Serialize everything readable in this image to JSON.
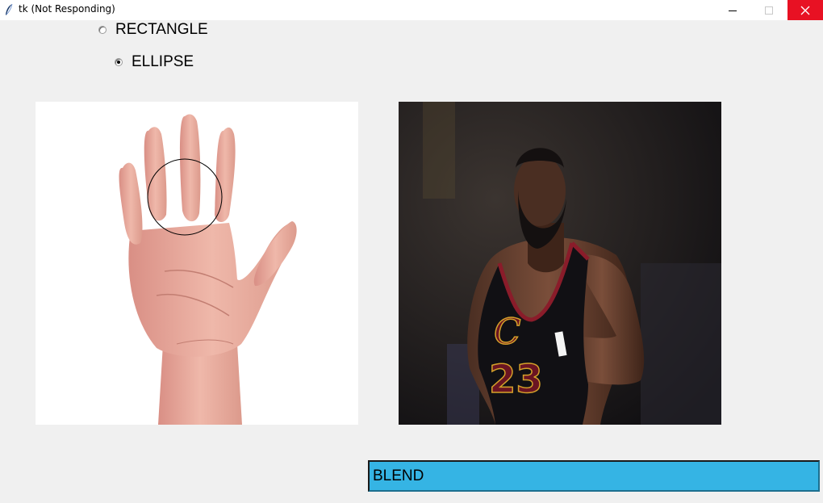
{
  "window": {
    "title": "tk (Not Responding)",
    "close_color": "#e81123"
  },
  "shape_options": [
    {
      "label": "RECTANGLE",
      "checked": false
    },
    {
      "label": "ELLIPSE",
      "checked": true
    }
  ],
  "images": {
    "left": {
      "subject": "open-palm-hand",
      "overlay_shape": "ellipse"
    },
    "right": {
      "subject": "basketball-player-portrait",
      "jersey_number": "23"
    }
  },
  "blend_button": {
    "label": "BLEND",
    "color": "#35b4e4"
  }
}
